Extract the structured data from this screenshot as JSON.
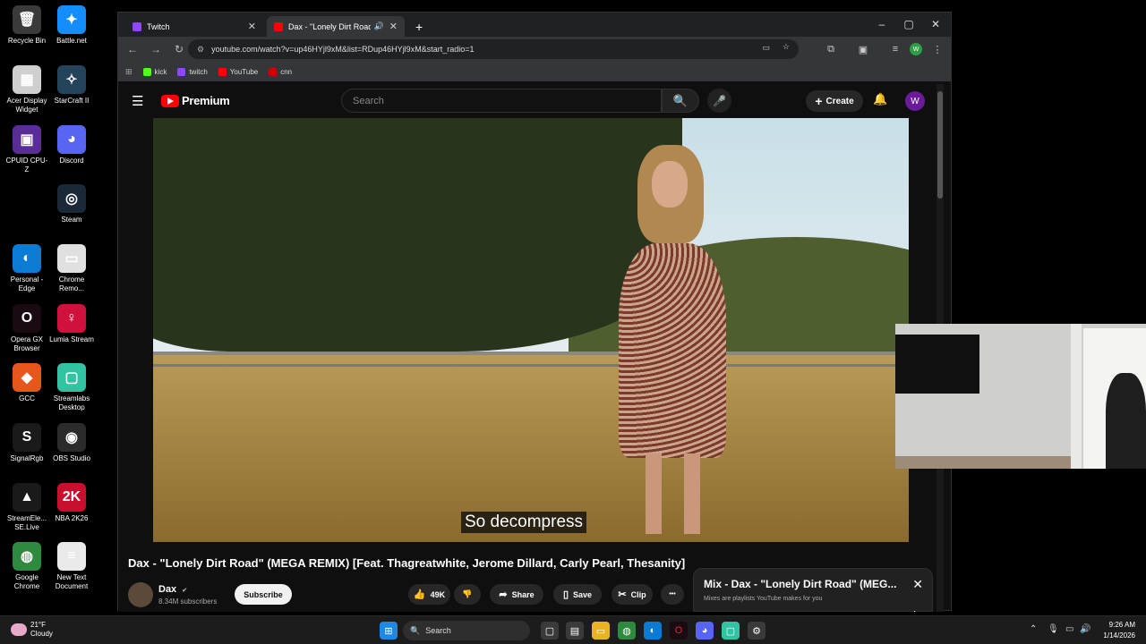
{
  "desktop": {
    "icons": [
      {
        "label": "Recycle Bin",
        "glyph": "🗑",
        "bg": "#3a3a3a"
      },
      {
        "label": "Battle.net",
        "glyph": "✦",
        "bg": "#148eff"
      },
      {
        "label": "Acer Display Widget",
        "glyph": "▦",
        "bg": "#cfcfcf"
      },
      {
        "label": "StarCraft II",
        "glyph": "✧",
        "bg": "#23435a"
      },
      {
        "label": "CPUID CPU-Z",
        "glyph": "▣",
        "bg": "#5a2c96"
      },
      {
        "label": "Discord",
        "glyph": "◕",
        "bg": "#5865f2"
      },
      {
        "label": "Steam",
        "glyph": "◎",
        "bg": "#1b2838"
      },
      {
        "label": "Personal - Edge",
        "glyph": "◐",
        "bg": "#0c7bd3"
      },
      {
        "label": "Chrome Remo...",
        "glyph": "▭",
        "bg": "#e0e0e0"
      },
      {
        "label": "Opera GX Browser",
        "glyph": "O",
        "bg": "#1a0b12"
      },
      {
        "label": "Lumia Stream",
        "glyph": "♀",
        "bg": "#d0113d"
      },
      {
        "label": "GCC",
        "glyph": "◆",
        "bg": "#e7561d"
      },
      {
        "label": "Streamlabs Desktop",
        "glyph": "▢",
        "bg": "#31c3a2"
      },
      {
        "label": "SignalRgb",
        "glyph": "S",
        "bg": "#1a1a1a"
      },
      {
        "label": "OBS Studio",
        "glyph": "◉",
        "bg": "#2b2b2b"
      },
      {
        "label": "StreamEle... SE.Live",
        "glyph": "▲",
        "bg": "#1a1a1a"
      },
      {
        "label": "NBA 2K26",
        "glyph": "2K",
        "bg": "#c8102e"
      },
      {
        "label": "Google Chrome",
        "glyph": "◍",
        "bg": "#2d8a3e"
      },
      {
        "label": "New Text Document",
        "glyph": "≡",
        "bg": "#eaeaea"
      }
    ]
  },
  "browser": {
    "tabs": [
      {
        "title": "Twitch",
        "fav_color": "#9146ff",
        "active": false
      },
      {
        "title": "Dax - \"Lonely Dirt Road\" (M",
        "fav_color": "#ff0000",
        "active": true
      }
    ],
    "new_tab": "+",
    "window_controls": {
      "minimize": "–",
      "maximize": "▢",
      "close": "✕"
    },
    "url": "youtube.com/watch?v=up46HYjl9xM&list=RDup46HYjl9xM&start_radio=1",
    "profile_initial": "W",
    "bookmarks": [
      {
        "label": "kick",
        "color": "#53fc18"
      },
      {
        "label": "twitch",
        "color": "#9146ff"
      },
      {
        "label": "YouTube",
        "color": "#ff0000"
      },
      {
        "label": "cnn",
        "color": "#cc0000"
      }
    ]
  },
  "youtube": {
    "logo_text": "Premium",
    "search_placeholder": "Search",
    "create_label": "Create",
    "avatar_initial": "W",
    "caption": "So decompress",
    "video_title": "Dax - \"Lonely Dirt Road\" (MEGA REMIX) [Feat. Thagreatwhite, Jerome Dillard, Carly Pearl, Thesanity]",
    "channel_name": "Dax",
    "verified": "✔",
    "subscribers": "8.34M subscribers",
    "subscribe_label": "Subscribe",
    "likes": "49K",
    "share_label": "Share",
    "save_label": "Save",
    "clip_label": "Clip",
    "more_label": "•••",
    "mix_title": "Mix - Dax - \"Lonely Dirt Road\" (MEG...",
    "mix_subtitle": "Mixes are playlists YouTube makes for you"
  },
  "taskbar": {
    "temperature": "21°F",
    "weather": "Cloudy",
    "search_label": "Search",
    "time": "9:26 AM",
    "date": "1/14/2026"
  }
}
